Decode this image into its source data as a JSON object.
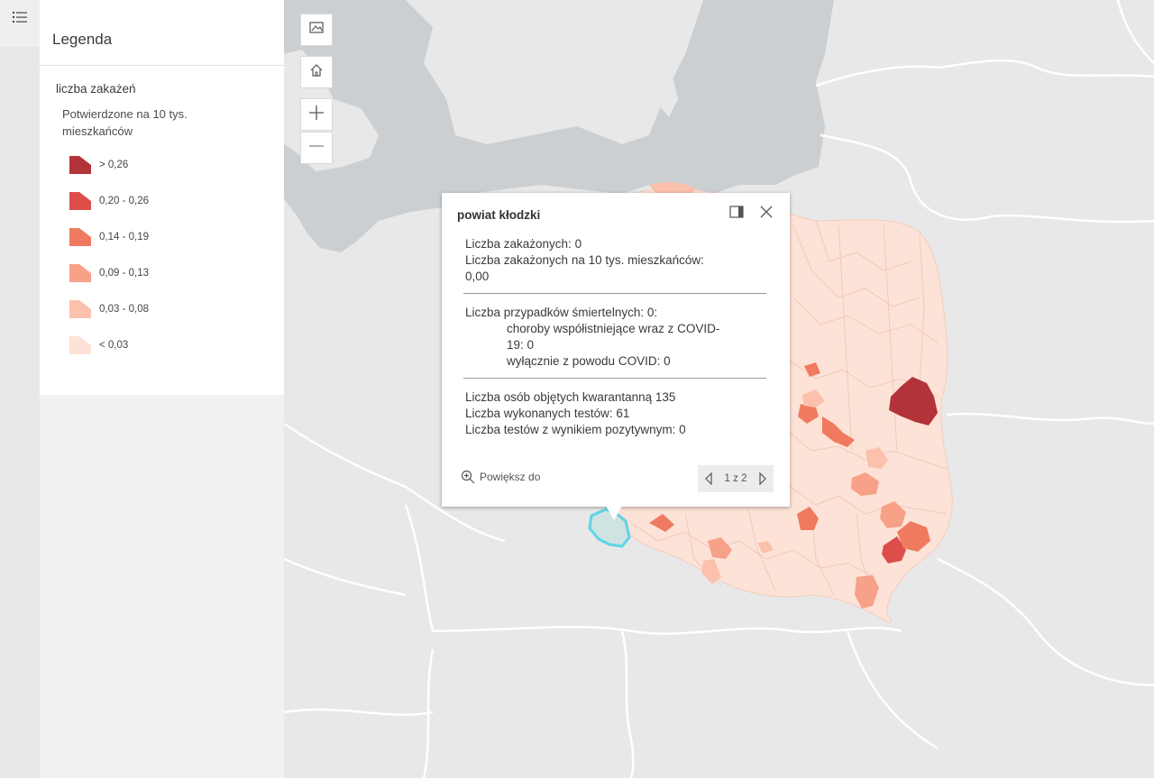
{
  "sidebar": {
    "toggle_icon": "list-icon"
  },
  "legend": {
    "title": "Legenda",
    "layer_name": "liczba zakażeń",
    "description": "Potwierdzone na 10 tys. mieszkańców",
    "classes": [
      {
        "label": "> 0,26",
        "color": "#b3333a"
      },
      {
        "label": "0,20 - 0,26",
        "color": "#dd4e4b"
      },
      {
        "label": "0,14 - 0,19",
        "color": "#f07a5f"
      },
      {
        "label": "0,09 - 0,13",
        "color": "#f7a188"
      },
      {
        "label": "0,03 - 0,08",
        "color": "#fbc1ac"
      },
      {
        "label": "< 0,03",
        "color": "#fde2d7"
      }
    ]
  },
  "map_controls": {
    "basemap_icon": "basemap-gallery-icon",
    "home_icon": "home-icon",
    "zoom_in_icon": "plus-icon",
    "zoom_out_icon": "minus-icon"
  },
  "popup": {
    "title": "powiat kłodzki",
    "dock_icon": "dock-icon",
    "close_icon": "close-icon",
    "lines": {
      "infections": "Liczba zakażonych: 0",
      "infections_per_10k_label": "Liczba zakażonych na 10 tys. mieszkańców:",
      "infections_per_10k_value": "0,00",
      "deaths": "Liczba przypadków śmiertelnych: 0:",
      "comorbid_line1": "choroby współistniejące wraz z COVID-",
      "comorbid_line2": "19: 0",
      "covid_only": "wyłącznie z powodu COVID: 0",
      "quarantine": "Liczba osób objętych kwarantanną 135",
      "tests": "Liczba wykonanych testów: 61",
      "positive_tests": "Liczba testów z wynikiem pozytywnym: 0"
    },
    "zoom_to": "Powiększ do",
    "pager": "1 z 2"
  },
  "colors": {
    "water": "#cbcfd2",
    "land": "#e9e9e9",
    "poland_base": "#fde2d7",
    "border": "#ffffff",
    "selection": "#5fd4e3"
  }
}
